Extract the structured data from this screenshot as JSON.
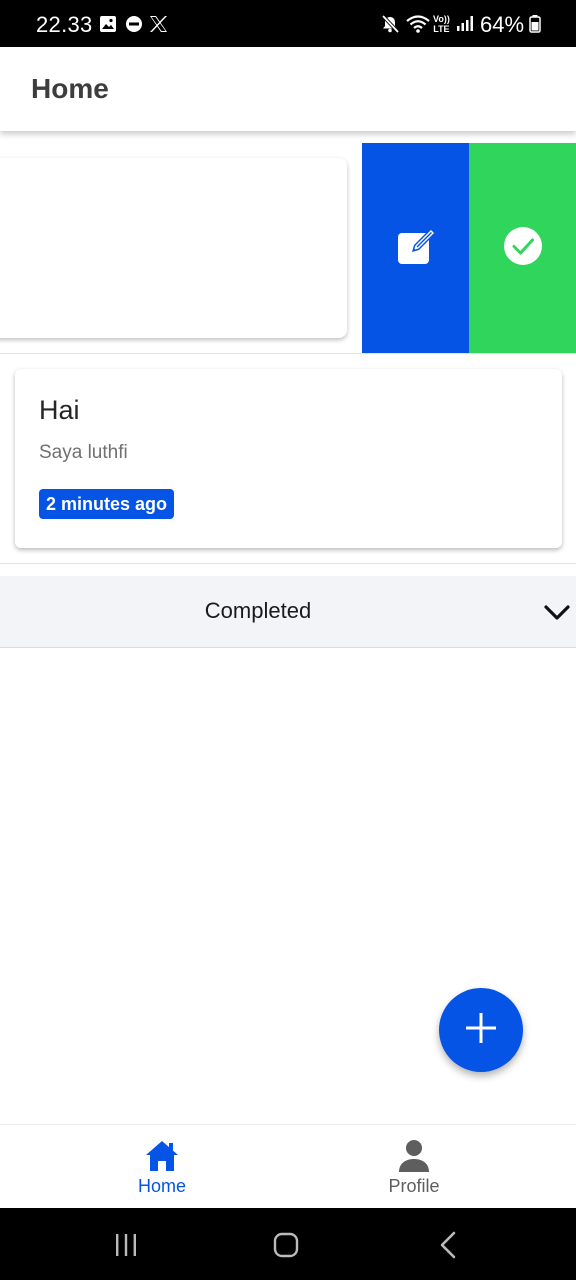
{
  "status_bar": {
    "time": "22.33",
    "battery": "64%",
    "icons": [
      "gallery-icon",
      "do-not-disturb-icon",
      "x-icon",
      "mute-icon",
      "wifi-icon",
      "volte-icon",
      "signal-icon",
      "battery-icon"
    ],
    "volte_top": "Vo))",
    "volte_bottom": "LTE"
  },
  "app_bar": {
    "title": "Home"
  },
  "swipe_actions": {
    "edit": {
      "icon": "edit-icon",
      "color": "#0554e6"
    },
    "complete": {
      "icon": "check-circle-icon",
      "color": "#2fd65b"
    }
  },
  "task": {
    "title": "Hai",
    "description": "Saya luthfi",
    "time_badge": "2 minutes ago"
  },
  "completed_section": {
    "label": "Completed",
    "icon": "chevron-down-icon"
  },
  "fab": {
    "icon": "plus-icon",
    "color": "#0554e6"
  },
  "bottom_nav": {
    "items": [
      {
        "label": "Home",
        "icon": "home-icon",
        "active": true
      },
      {
        "label": "Profile",
        "icon": "person-icon",
        "active": false
      }
    ]
  },
  "colors": {
    "accent": "#0554e6",
    "success": "#2fd65b"
  }
}
